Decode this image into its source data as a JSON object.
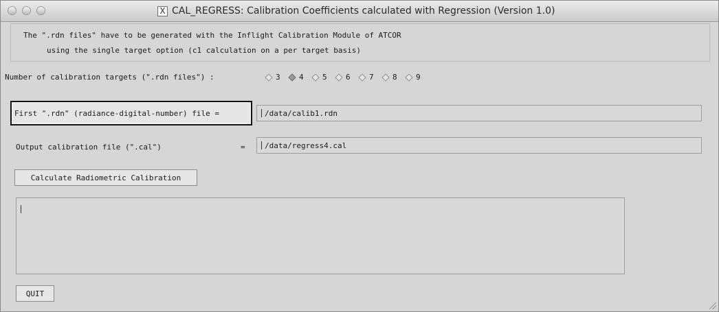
{
  "window": {
    "title": "CAL_REGRESS: Calibration Coefficients calculated with Regression (Version 1.0)",
    "title_icon": "X"
  },
  "intro": {
    "line1": "The \".rdn files\" have to be generated with the Inflight Calibration Module of ATCOR",
    "line2": "using the single target option (c1 calculation on a per target basis)"
  },
  "targets": {
    "label": "Number of calibration targets (\".rdn files\") :",
    "options": [
      "3",
      "4",
      "5",
      "6",
      "7",
      "8",
      "9"
    ],
    "selected": "4"
  },
  "first_file": {
    "button_label": "First \".rdn\" (radiance-digital-number) file =",
    "value": "/data/calib1.rdn"
  },
  "output_file": {
    "label": "Output calibration file (\".cal\")",
    "equals": "=",
    "value": "/data/regress4.cal"
  },
  "buttons": {
    "calculate": "Calculate Radiometric Calibration",
    "quit": "QUIT"
  },
  "log": {
    "text": ""
  }
}
